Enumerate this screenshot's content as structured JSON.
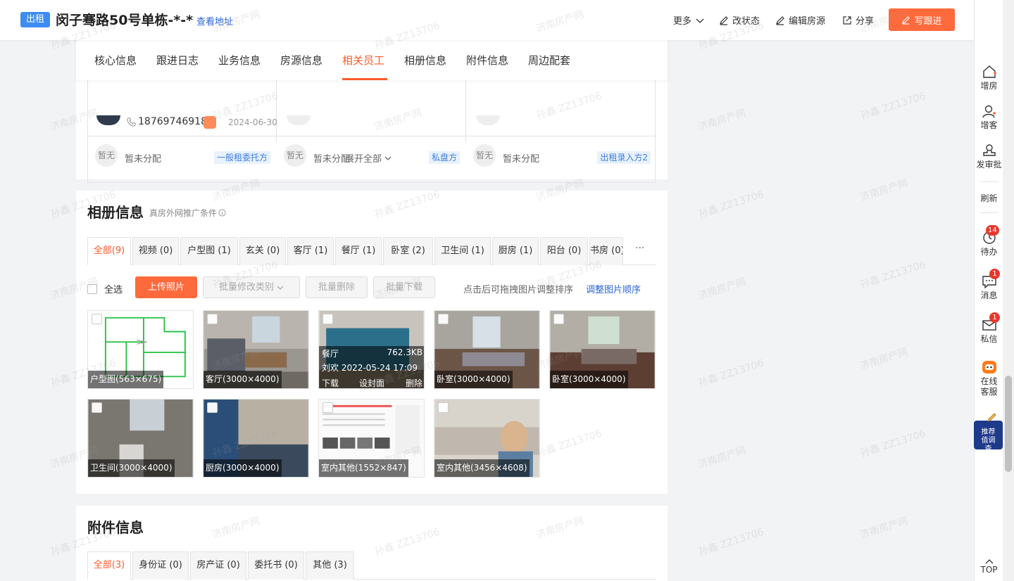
{
  "header": {
    "badge": "出租",
    "title": "闵子骞路50号单栋-*-*",
    "view_address": "查看地址",
    "more": "更多",
    "change_status": "改状态",
    "edit_listing": "编辑房源",
    "share": "分享",
    "write_followup": "写跟进"
  },
  "nav_tabs": [
    "核心信息",
    "跟进日志",
    "业务信息",
    "房源信息",
    "相关员工",
    "相册信息",
    "附件信息",
    "周边配套"
  ],
  "staff": {
    "phone": "18769746918",
    "date": "2024-06-30",
    "cells": [
      {
        "avatar": "暂无",
        "text": "暂未分配",
        "tag": "一般租委托方"
      },
      {
        "avatar": "暂无",
        "text": "暂未分配",
        "tag": "私盘方"
      },
      {
        "avatar": "暂无",
        "text": "暂未分配",
        "tag": "出租录入方2"
      }
    ],
    "expand": "展开全部"
  },
  "album": {
    "title": "相册信息",
    "subtitle": "真房外网推广条件",
    "tabs": [
      "全部(9)",
      "视频 (0)",
      "户型图 (1)",
      "玄关 (0)",
      "客厅 (1)",
      "餐厅 (1)",
      "卧室 (2)",
      "卫生间 (1)",
      "厨房 (1)",
      "阳台 (0)",
      "书房 (0)"
    ],
    "more": "···",
    "select_all": "全选",
    "upload": "上传照片",
    "batch_edit": "批量修改类别",
    "batch_delete": "批量删除",
    "batch_download": "批量下载",
    "hint": "点击后可拖拽图片调整排序",
    "hint_link": "调整图片顺序",
    "photos": [
      {
        "caption": "户型图(563×675)"
      },
      {
        "caption": "客厅(3000×4000)"
      },
      {
        "caption": ""
      },
      {
        "caption": "卧室(3000×4000)"
      },
      {
        "caption": "卧室(3000×4000)"
      },
      {
        "caption": "卫生间(3000×4000)"
      },
      {
        "caption": "厨房(3000×4000)"
      },
      {
        "caption": "室内其他(1552×847)"
      },
      {
        "caption": "室内其他(3456×4608)"
      }
    ],
    "hover_photo": {
      "name": "餐厅",
      "size": "762.3KB",
      "user_time": "刘欢 2022-05-24 17:09",
      "download": "下载",
      "set_cover": "设封面",
      "delete": "删除"
    }
  },
  "attachments": {
    "title": "附件信息",
    "tabs": [
      "全部(3)",
      "身份证 (0)",
      "房产证 (0)",
      "委托书 (0)",
      "其他 (3)"
    ]
  },
  "sidebar": {
    "add_house": "增房",
    "add_client": "增客",
    "approval": "发审批",
    "refresh": "刷新",
    "todo": "待办",
    "todo_count": "14",
    "messages": "消息",
    "messages_count": "1",
    "private_msg": "私信",
    "private_count": "1",
    "online_service": "在线客服",
    "recommend": "推荐值调查",
    "top": "TOP"
  },
  "watermarks": [
    "孙鑫 ZZ13706",
    "济南房产网"
  ],
  "colors": {
    "accent": "#ff6a3d",
    "link": "#2a64d6",
    "badge": "#3d8cf0"
  }
}
